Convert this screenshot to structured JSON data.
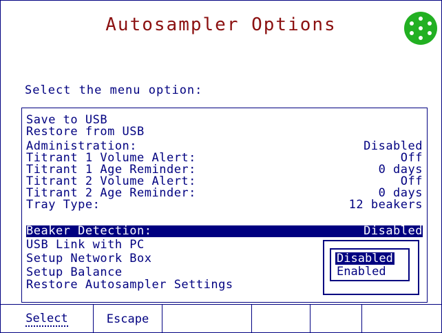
{
  "header": {
    "title": "Autosampler Options"
  },
  "prompt": "Select the menu option:",
  "menu": [
    {
      "label": "Save to USB",
      "value": ""
    },
    {
      "label": "Restore from USB",
      "value": ""
    },
    {
      "label": "Administration:",
      "value": "Disabled"
    },
    {
      "label": "Titrant 1 Volume Alert:",
      "value": "Off"
    },
    {
      "label": "Titrant 1 Age Reminder:",
      "value": "0 days"
    },
    {
      "label": "Titrant 2 Volume Alert:",
      "value": "Off"
    },
    {
      "label": "Titrant 2 Age Reminder:",
      "value": "0 days"
    },
    {
      "label": "Tray Type:",
      "value": "12 beakers"
    },
    {
      "label": "Beaker Detection:",
      "value": "Disabled"
    },
    {
      "label": "USB Link with PC",
      "value": ""
    },
    {
      "label": "Setup Network Box",
      "value": ""
    },
    {
      "label": "Setup Balance",
      "value": ""
    },
    {
      "label": "Restore Autosampler Settings",
      "value": ""
    }
  ],
  "popup": {
    "options": [
      "Disabled",
      "Enabled"
    ],
    "selected_index": 0
  },
  "softkeys": [
    "Select",
    "Escape",
    "",
    "",
    "",
    ""
  ],
  "colors": {
    "primary": "#000080",
    "title": "#8b1010",
    "logo": "#22b022"
  }
}
